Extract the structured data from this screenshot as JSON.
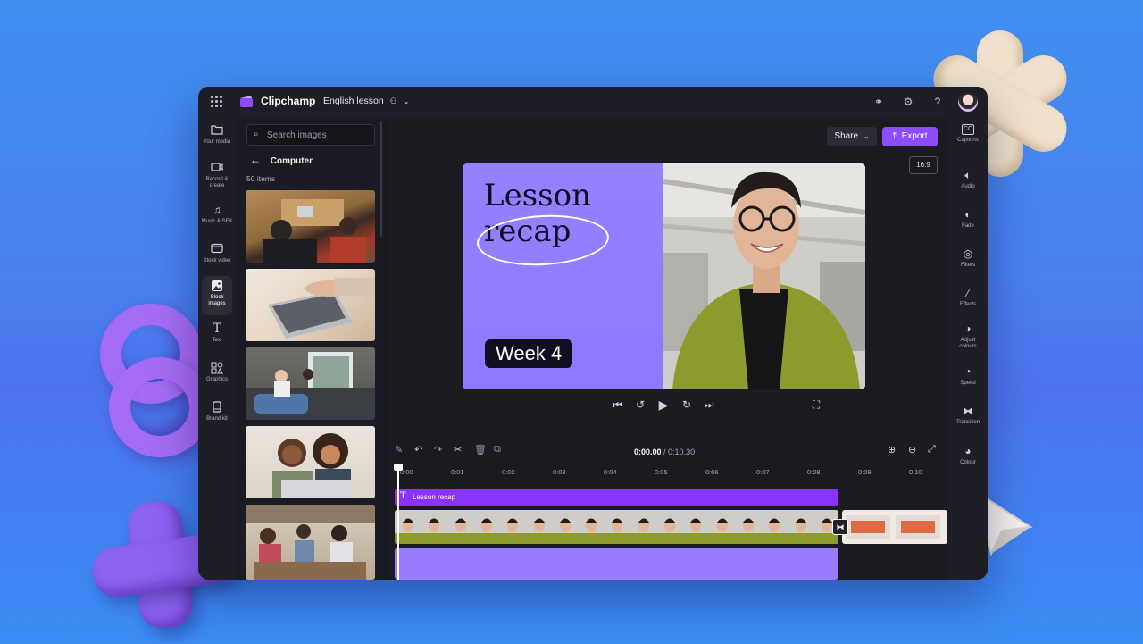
{
  "app": {
    "brand": "Clipchamp",
    "project_name": "English lesson"
  },
  "left_nav": [
    {
      "label": "Your media",
      "icon": "folder-icon"
    },
    {
      "label": "Record & create",
      "icon": "video-camera-icon"
    },
    {
      "label": "Music & SFX",
      "icon": "music-note-icon"
    },
    {
      "label": "Stock video",
      "icon": "film-icon"
    },
    {
      "label": "Stock images",
      "icon": "image-icon",
      "active": true
    },
    {
      "label": "Text",
      "icon": "text-icon"
    },
    {
      "label": "Graphics",
      "icon": "shapes-icon"
    },
    {
      "label": "Brand kit",
      "icon": "brand-kit-icon"
    }
  ],
  "media_panel": {
    "search_placeholder": "Search images",
    "folder": "Computer",
    "item_count": "50 items"
  },
  "preview": {
    "share_label": "Share",
    "export_label": "Export",
    "aspect_ratio": "16:9",
    "canvas": {
      "title_line1": "Lesson",
      "title_line2": "recap",
      "week_label": "Week 4"
    }
  },
  "timeline": {
    "current_time": "0:00.00",
    "total_time": "/ 0:10.30",
    "ruler": [
      "0:00",
      "0:01",
      "0:02",
      "0:03",
      "0:04",
      "0:05",
      "0:06",
      "0:07",
      "0:08",
      "0:09",
      "0:10"
    ],
    "text_clip_label": "Lesson recap",
    "text_clip_icon": "T"
  },
  "right_nav": [
    {
      "label": "Captions",
      "icon": "captions-icon"
    },
    {
      "label": "Audio",
      "icon": "speaker-icon"
    },
    {
      "label": "Fade",
      "icon": "fade-icon"
    },
    {
      "label": "Filters",
      "icon": "filters-icon"
    },
    {
      "label": "Effects",
      "icon": "magic-wand-icon"
    },
    {
      "label": "Adjust colours",
      "icon": "contrast-icon"
    },
    {
      "label": "Speed",
      "icon": "speedometer-icon"
    },
    {
      "label": "Transition",
      "icon": "transition-icon"
    },
    {
      "label": "Colour",
      "icon": "palette-icon"
    }
  ],
  "colors": {
    "accent": "#8c4cff",
    "canvas_purple": "#8f7cff",
    "text_track": "#8a33ff",
    "audio_track": "#9b7cff",
    "background": "#4a7ff0"
  }
}
